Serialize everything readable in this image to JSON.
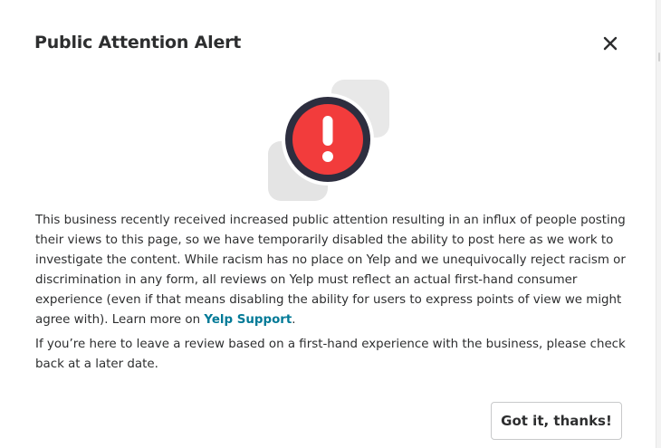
{
  "modal": {
    "title": "Public Attention Alert",
    "close_icon": "close-icon",
    "illustration_icon": "exclamation-alert-icon",
    "paragraph1": {
      "text": "This business recently received increased public attention resulting in an influx of people posting their views to this page, so we have temporarily disabled the ability to post here as we work to investigate the content. While racism has no place on Yelp and we unequivocally reject racism or discrimination in any form, all reviews on Yelp must reflect an actual first-hand consumer experience (even if that means disabling the ability for users to express points of view we might agree with). Learn more on ",
      "link_label": "Yelp Support",
      "trailing": "."
    },
    "paragraph2": "If you’re here to leave a review based on a first-hand experience with the business, please check back at a later date.",
    "confirm_button_label": "Got it, thanks!"
  },
  "colors": {
    "alert_red": "#f23c3c",
    "alert_ring": "#2d2e3f",
    "link": "#027a97",
    "text": "#2d2e2f",
    "illustration_gray": "#e5e5e5"
  }
}
